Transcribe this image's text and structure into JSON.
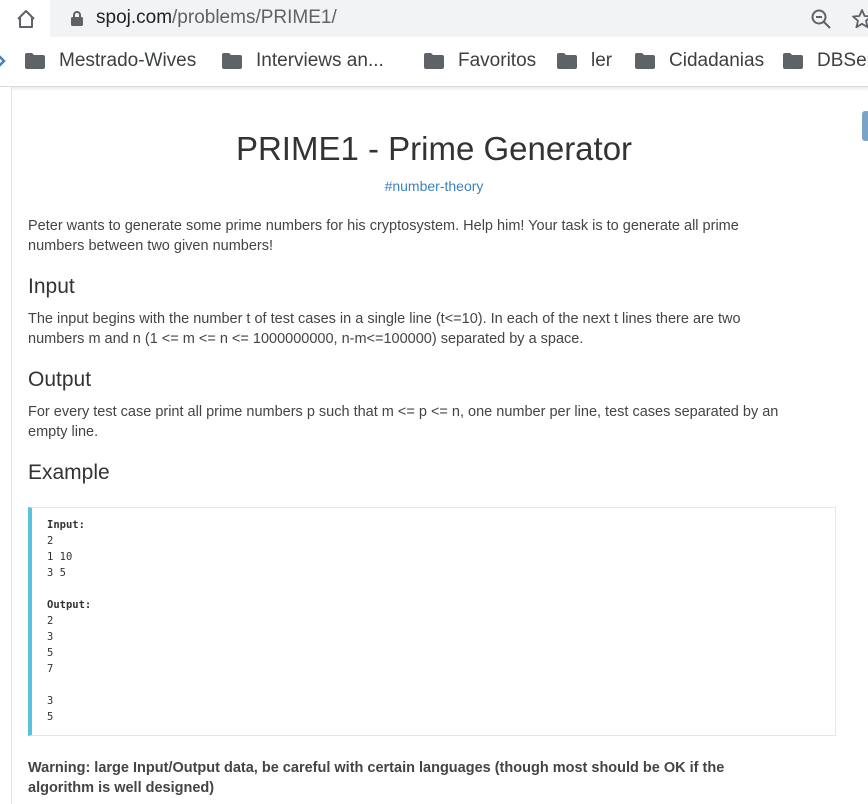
{
  "browser": {
    "url_host": "spoj.com",
    "url_path": "/problems/PRIME1/",
    "bookmarks": [
      {
        "label": "Mestrado-Wives"
      },
      {
        "label": "Interviews an..."
      },
      {
        "label": "Favoritos"
      },
      {
        "label": "ler"
      },
      {
        "label": "Cidadanias"
      },
      {
        "label": "DBSer"
      }
    ]
  },
  "problem": {
    "title": "PRIME1 - Prime Generator",
    "tag": "#number-theory",
    "intro_line1": "Peter wants to generate some prime numbers for his cryptosystem. Help him! Your task is to generate all prime",
    "intro_line2": "numbers between two given numbers!",
    "input_heading": "Input",
    "input_line1": "The input begins with the number t of test cases in a single line (t<=10). In each of the next t lines there are two",
    "input_line2": "numbers m and n (1 <= m <= n <= 1000000000, n-m<=100000) separated by a space.",
    "output_heading": "Output",
    "output_line1": "For every test case print all prime numbers p such that m <= p <= n, one number per line, test cases separated by an",
    "output_line2": "empty line.",
    "example_heading": "Example",
    "example": {
      "input_label": "Input:",
      "input_lines": [
        "2",
        "1 10",
        "3 5"
      ],
      "output_label": "Output:",
      "output_lines": [
        "2",
        "3",
        "5",
        "7",
        "",
        "3",
        "5"
      ]
    },
    "warning_line1": "Warning: large Input/Output data, be careful with certain languages (though most should be OK if the",
    "warning_line2": "algorithm is well designed)"
  },
  "colors": {
    "accent_link": "#3d82c0",
    "example_border": "#5bc0de"
  }
}
